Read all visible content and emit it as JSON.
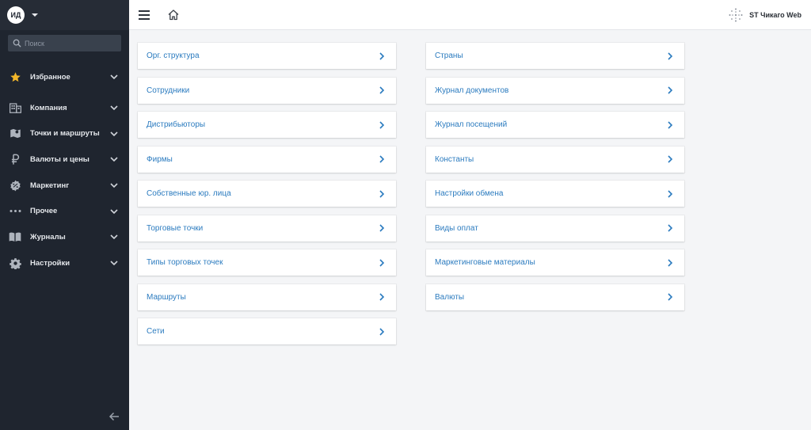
{
  "user": {
    "initials": "ИД"
  },
  "search": {
    "placeholder": "Поиск"
  },
  "sidebar": {
    "items": [
      {
        "label": "Избранное",
        "icon": "star-icon"
      },
      {
        "label": "Компания",
        "icon": "building-icon"
      },
      {
        "label": "Точки и маршруты",
        "icon": "map-icon"
      },
      {
        "label": "Валюты и цены",
        "icon": "ruble-icon"
      },
      {
        "label": "Маркетинг",
        "icon": "badge-icon"
      },
      {
        "label": "Прочее",
        "icon": "more-dots-icon"
      },
      {
        "label": "Журналы",
        "icon": "book-icon"
      },
      {
        "label": "Настройки",
        "icon": "gear-icon"
      }
    ]
  },
  "brand": {
    "name": "ST Чикаго Web"
  },
  "colors": {
    "accent": "#2b7bbf",
    "sidebar": "#1f252f",
    "star": "#f3b72a"
  },
  "left_column": [
    "Орг. структура",
    "Сотрудники",
    "Дистрибьюторы",
    "Фирмы",
    "Собственные юр. лица",
    "Торговые точки",
    "Типы торговых точек",
    "Маршруты",
    "Сети"
  ],
  "right_column": [
    "Страны",
    "Журнал документов",
    "Журнал посещений",
    "Константы",
    "Настройки обмена",
    "Виды оплат",
    "Маркетинговые материалы",
    "Валюты"
  ]
}
